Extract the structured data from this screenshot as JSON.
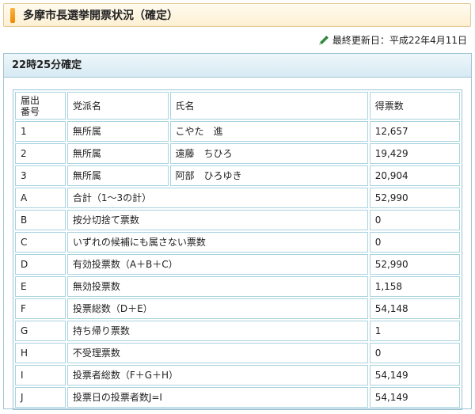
{
  "page_title": "多摩市長選挙開票状況（確定）",
  "last_updated": "最終更新日：平成22年4月11日",
  "section_title": "22時25分確定",
  "table": {
    "headers": [
      "届出\n番号",
      "党派名",
      "氏名",
      "得票数"
    ],
    "candidates": [
      {
        "no": "1",
        "party": "無所属",
        "name": "こやた　進",
        "votes": "12,657"
      },
      {
        "no": "2",
        "party": "無所属",
        "name": "遠藤　ちひろ",
        "votes": "19,429"
      },
      {
        "no": "3",
        "party": "無所属",
        "name": "阿部　ひろゆき",
        "votes": "20,904"
      }
    ],
    "summary": [
      {
        "code": "A",
        "label": "合計（1～3の計）",
        "value": "52,990"
      },
      {
        "code": "B",
        "label": "按分切捨て票数",
        "value": "0"
      },
      {
        "code": "C",
        "label": "いずれの候補にも属さない票数",
        "value": "0"
      },
      {
        "code": "D",
        "label": "有効投票数（A＋B＋C）",
        "value": "52,990"
      },
      {
        "code": "E",
        "label": "無効投票数",
        "value": "1,158"
      },
      {
        "code": "F",
        "label": "投票総数（D＋E）",
        "value": "54,148"
      },
      {
        "code": "G",
        "label": "持ち帰り票数",
        "value": "1"
      },
      {
        "code": "H",
        "label": "不受理票数",
        "value": "0"
      },
      {
        "code": "I",
        "label": "投票者総数（F＋G＋H）",
        "value": "54,149"
      },
      {
        "code": "J",
        "label": "投票日の投票者数J=I",
        "value": "54,149"
      }
    ]
  },
  "colors": {
    "title_accent": "#f39a10",
    "panel_border": "#9dc4d4",
    "pencil_icon": "#2e8b3a"
  },
  "icons": {
    "title": "orange-bar-marker",
    "updated": "pencil-icon"
  }
}
